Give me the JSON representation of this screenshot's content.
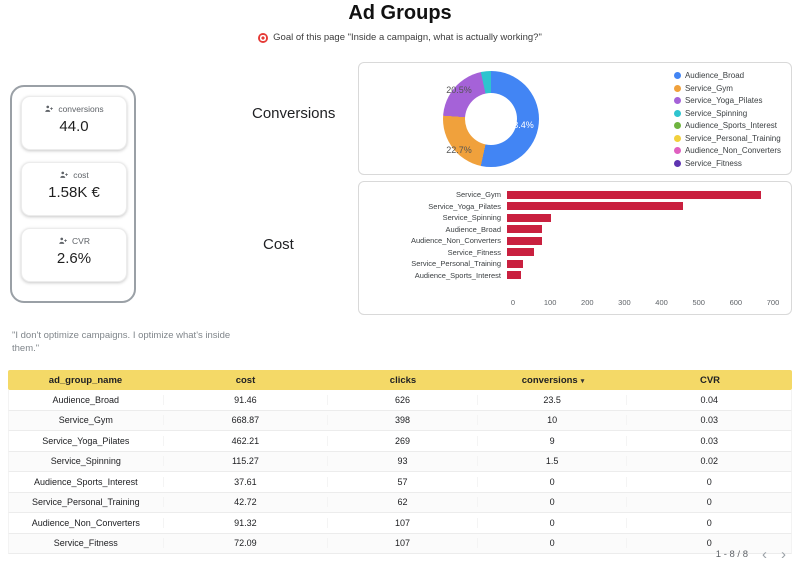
{
  "header": {
    "title": "Ad Groups",
    "goal_text": "Goal of this page \"Inside a campaign, what is actually working?\""
  },
  "kpis": [
    {
      "label": "conversions",
      "value": "44.0"
    },
    {
      "label": "cost",
      "value": "1.58K €"
    },
    {
      "label": "CVR",
      "value": "2.6%"
    }
  ],
  "sections": {
    "conversions_label": "Conversions",
    "cost_label": "Cost"
  },
  "quote": "\"I don't optimize campaigns. I optimize what's inside them.\"",
  "chart_data": [
    {
      "type": "pie",
      "variant": "donut",
      "title": "Conversions",
      "labels": [
        "Audience_Broad",
        "Service_Gym",
        "Service_Yoga_Pilates",
        "Service_Spinning",
        "Audience_Sports_Interest",
        "Service_Personal_Training",
        "Audience_Non_Converters",
        "Service_Fitness"
      ],
      "values": [
        23.5,
        10,
        9,
        1.5,
        0,
        0,
        0,
        0
      ],
      "percents": [
        53.4,
        22.7,
        20.5,
        3.4,
        0,
        0,
        0,
        0
      ],
      "slice_labels": [
        "53.4%",
        "22.7%",
        "20.5%"
      ],
      "colors": [
        "#4285f4",
        "#f0a13c",
        "#a562d8",
        "#2ec4cf",
        "#6fb43f",
        "#f2d03c",
        "#e060c0",
        "#5e35b1"
      ],
      "legend_position": "right"
    },
    {
      "type": "bar",
      "orientation": "horizontal",
      "title": "Cost",
      "categories": [
        "Service_Gym",
        "Service_Yoga_Pilates",
        "Service_Spinning",
        "Audience_Broad",
        "Audience_Non_Converters",
        "Service_Fitness",
        "Service_Personal_Training",
        "Audience_Sports_Interest"
      ],
      "values": [
        668.87,
        462.21,
        115.27,
        91.46,
        91.32,
        72.09,
        42.72,
        37.61
      ],
      "bar_color": "#c9203f",
      "xlim": [
        0,
        700
      ],
      "xticks": [
        0,
        100,
        200,
        300,
        400,
        500,
        600,
        700
      ]
    }
  ],
  "table": {
    "header_bg": "#f4d967",
    "sort_icon": "▾",
    "headers": [
      {
        "label": "ad_group_name",
        "sorted": false
      },
      {
        "label": "cost",
        "sorted": false
      },
      {
        "label": "clicks",
        "sorted": false
      },
      {
        "label": "conversions",
        "sorted": true
      },
      {
        "label": "CVR",
        "sorted": false
      }
    ],
    "rows": [
      [
        "Audience_Broad",
        "91.46",
        "626",
        "23.5",
        "0.04"
      ],
      [
        "Service_Gym",
        "668.87",
        "398",
        "10",
        "0.03"
      ],
      [
        "Service_Yoga_Pilates",
        "462.21",
        "269",
        "9",
        "0.03"
      ],
      [
        "Service_Spinning",
        "115.27",
        "93",
        "1.5",
        "0.02"
      ],
      [
        "Audience_Sports_Interest",
        "37.61",
        "57",
        "0",
        "0"
      ],
      [
        "Service_Personal_Training",
        "42.72",
        "62",
        "0",
        "0"
      ],
      [
        "Audience_Non_Converters",
        "91.32",
        "107",
        "0",
        "0"
      ],
      [
        "Service_Fitness",
        "72.09",
        "107",
        "0",
        "0"
      ]
    ]
  },
  "pagination": {
    "label": "1 - 8 / 8",
    "prev_icon": "‹",
    "next_icon": "›"
  }
}
